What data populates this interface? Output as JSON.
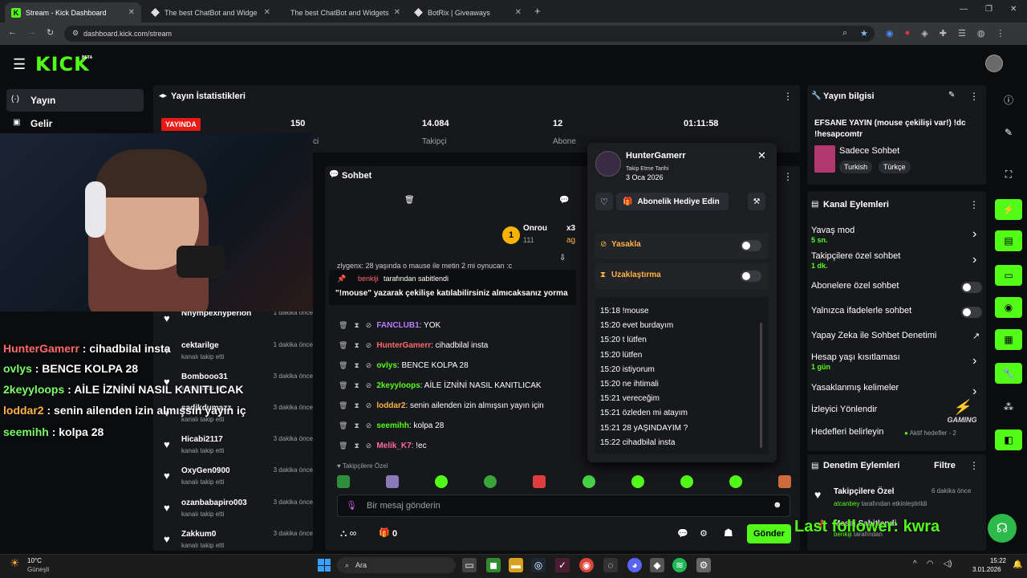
{
  "browser": {
    "tabs": [
      {
        "label": "Stream - Kick Dashboard"
      },
      {
        "label": "The best ChatBot and Widge"
      },
      {
        "label": "The best ChatBot and Widgets"
      },
      {
        "label": "BotRix | Giveaways"
      }
    ],
    "url": "dashboard.kick.com/stream",
    "new_tab": "+"
  },
  "kick": {
    "logo": "KICK",
    "beta": "BETA"
  },
  "sidebar": {
    "items": [
      {
        "label": "Yayın"
      },
      {
        "label": "Gelir"
      }
    ]
  },
  "stats": {
    "title": "Yayın İstatistikleri",
    "live_badge": "YAYINDA",
    "viewers_value": "150",
    "viewers_label": "ci",
    "followers_value": "14.084",
    "followers_label": "Takipçi",
    "subs_value": "12",
    "subs_label": "Abone",
    "duration": "01:11:58"
  },
  "chat": {
    "title": "Sohbet",
    "top_user": "Onrou",
    "top_count": "111",
    "top_badge": "1",
    "top_x": "x3",
    "top_ag": "ag",
    "partial_line": "zlygenx: 28 yaşında o mause ile metin 2 mi oynucan :c",
    "pinned_by_user": "benkiji",
    "pinned_by_text": "tarafından sabitlendi",
    "pinned_msg": "\"!mouse\" yazarak çekilişe katılabilirsiniz almıcaksanız yorma",
    "messages": [
      {
        "user": "FANCLUB1",
        "text": ": YOK",
        "color": "#b57cff"
      },
      {
        "user": "HunterGamerr",
        "text": ": cihadbilal insta",
        "color": "#ff6b6b"
      },
      {
        "user": "ovlys",
        "text": ": BENCE KOLPA 28",
        "color": "#53fc18"
      },
      {
        "user": "2keyyloops",
        "text": ": AİLE İZNİNİ NASIL KANITLICAK",
        "color": "#53fc18"
      },
      {
        "user": "loddar2",
        "text": ": senin ailenden izin almışsın yayın için",
        "color": "#ffb347"
      },
      {
        "user": "seemihh",
        "text": ": kolpa 28",
        "color": "#53fc18"
      },
      {
        "user": "Melik_K7",
        "text": ": !ec",
        "color": "#ff6b9a"
      }
    ],
    "followers_only": "Takipçilere Özel",
    "input_placeholder": "Bir mesaj gönderin",
    "count": "0",
    "send": "Gönder"
  },
  "popup": {
    "username": "HunterGamerr",
    "follow_label": "Takip Etme Tarihi",
    "follow_date": "3 Oca 2026",
    "gift_button": "Abonelik Hediye Edin",
    "ban": "Yasakla",
    "timeout": "Uzaklaştırma",
    "log": [
      "15:18 !mouse",
      "15:20 evet burdayım",
      "15:20 t lütfen",
      "15:20 lütfen",
      "15:20 istiyorum",
      "15:20 ne ihtimali",
      "15:21 vereceğim",
      "15:21 özleden mi atayım",
      "15:21 28 yAŞINDAYIM ?",
      "15:22 cihadbilal insta"
    ]
  },
  "followers": [
    {
      "name": "Nnympexhyperion",
      "sub": "",
      "time": "1 dakika önce"
    },
    {
      "name": "cektarilge",
      "sub": "kanalı takip etti",
      "time": "1 dakika önce"
    },
    {
      "name": "Bombooo31",
      "sub": "kanalı takip etti",
      "time": "3 dakika önce"
    },
    {
      "name": "sadikdumazz",
      "sub": "kanalı takip etti",
      "time": "3 dakika önce"
    },
    {
      "name": "Hicabi2117",
      "sub": "kanalı takip etti",
      "time": "3 dakika önce"
    },
    {
      "name": "OxyGen0900",
      "sub": "kanalı takip etti",
      "time": "3 dakika önce"
    },
    {
      "name": "ozanbabapiro003",
      "sub": "kanalı takip etti",
      "time": "3 dakika önce"
    },
    {
      "name": "Zakkum0",
      "sub": "kanalı takip etti",
      "time": "3 dakika önce"
    }
  ],
  "overlay_chat": [
    {
      "user": "HunterGamerr",
      "text": " : cihadbilal insta",
      "color": "#ff6b6b"
    },
    {
      "user": "ovlys",
      "text": " : BENCE KOLPA 28",
      "color": "#7cfc6a"
    },
    {
      "user": "2keyyloops",
      "text": " : AİLE İZNİNİ NASIL KANITLICAK",
      "color": "#7cfc6a"
    },
    {
      "user": "loddar2",
      "text": " : senin ailenden izin almışsın yayın iç",
      "color": "#ffb347"
    },
    {
      "user": "seemihh",
      "text": " : kolpa 28",
      "color": "#7cfc6a"
    }
  ],
  "stream_info": {
    "title": "Yayın bilgisi",
    "stream_title": "EFSANE YAYIN (mouse çekilişi var!) !dc !hesapcomtr",
    "category": "Sadece Sohbet",
    "tags": [
      "Turkish",
      "Türkçe"
    ]
  },
  "channel_actions": {
    "title": "Kanal Eylemleri",
    "items": [
      {
        "label": "Yavaş mod",
        "sub": "5 sn."
      },
      {
        "label": "Takipçilere özel sohbet",
        "sub": "1 dk."
      },
      {
        "label": "Abonelere özel sohbet",
        "sub": ""
      },
      {
        "label": "Yalnızca ifadelerle sohbet",
        "sub": ""
      },
      {
        "label": "Yapay Zeka ile Sohbet Denetimi",
        "sub": ""
      },
      {
        "label": "Hesap yaşı kısıtlaması",
        "sub": "1 gün"
      },
      {
        "label": "Yasaklanmış kelimeler",
        "sub": ""
      },
      {
        "label": "İzleyici Yönlendir",
        "sub": ""
      },
      {
        "label": "Hedefleri belirleyin",
        "sub": ""
      }
    ],
    "goal_status": "Aktif hedefler - 2"
  },
  "mod_actions": {
    "title": "Denetim Eylemleri",
    "filter": "Filtre",
    "items": [
      {
        "title": "Takipçilere Özel",
        "time": "6 dakika önce",
        "user": "atcanbey",
        "rest": "tarafından etkinleştirildi"
      },
      {
        "title": "Mesaj Sabitlendi",
        "time": "",
        "user": "benkiji",
        "rest": "tarafından"
      }
    ]
  },
  "last_follower": "Last follower: kwra",
  "gaming_logo": "GAMING",
  "taskbar": {
    "weather_temp": "10°C",
    "weather_desc": "Güneşli",
    "search": "Ara",
    "time": "15:22",
    "date": "3.01.2026"
  },
  "colors": {
    "accent": "#53fc18",
    "panel": "#17181c",
    "bg": "#0b0c0e",
    "live": "#e91916"
  }
}
